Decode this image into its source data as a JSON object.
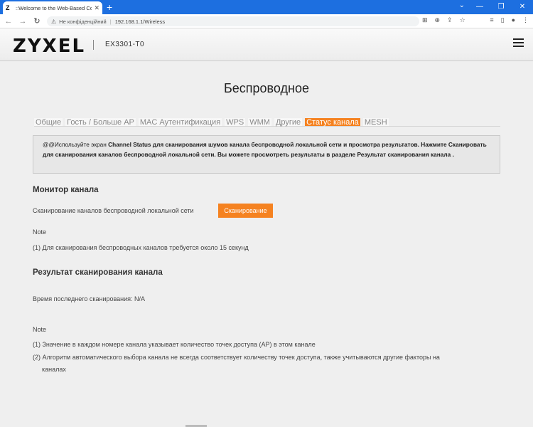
{
  "browser": {
    "tab_title": "::Welcome to the Web-Based Co",
    "favicon": "Z",
    "security_label": "Не конфіденційний",
    "url": "192.168.1.1/Wireless"
  },
  "header": {
    "logo": "ZYXEL",
    "model": "EX3301-T0"
  },
  "page": {
    "title": "Беспроводное",
    "tabs": [
      {
        "label": "Общие"
      },
      {
        "label": "Гость / Больше AP"
      },
      {
        "label": "MAC Аутентификация"
      },
      {
        "label": "WPS"
      },
      {
        "label": "WMM"
      },
      {
        "label": "Другие"
      },
      {
        "label": "Статус канала"
      },
      {
        "label": "MESH"
      }
    ],
    "active_tab": "Статус канала",
    "info": {
      "prefix": "@@Используйте экран ",
      "bold_rest": "Channel Status для сканирования шумов канала беспроводной локальной сети и просмотра результатов. Нажмите Сканировать для сканирования каналов беспроводной локальной сети. Вы можете просмотреть результаты в разделе Результат сканирования канала ."
    },
    "monitor": {
      "heading": "Монитор канала",
      "scan_label": "Сканирование каналов беспроводной локальной сети",
      "scan_button": "Сканирование",
      "note_title": "Note",
      "note_1": "(1) Для сканирования беспроводных каналов требуется около 15 секунд"
    },
    "result": {
      "heading": "Результат сканирования канала",
      "last_scan": "Время последнего сканирования: N/A",
      "note_title": "Note",
      "note_1": "(1) Значение в каждом номере канала указывает количество точек доступа (AP) в этом канале",
      "note_2a": "(2) Алгоритм автоматического выбора канала не всегда соответствует количеству точек доступа, также учитываются другие факторы на",
      "note_2b": "каналах"
    }
  },
  "colors": {
    "accent": "#f58220",
    "browser_blue": "#1d6fe0"
  }
}
